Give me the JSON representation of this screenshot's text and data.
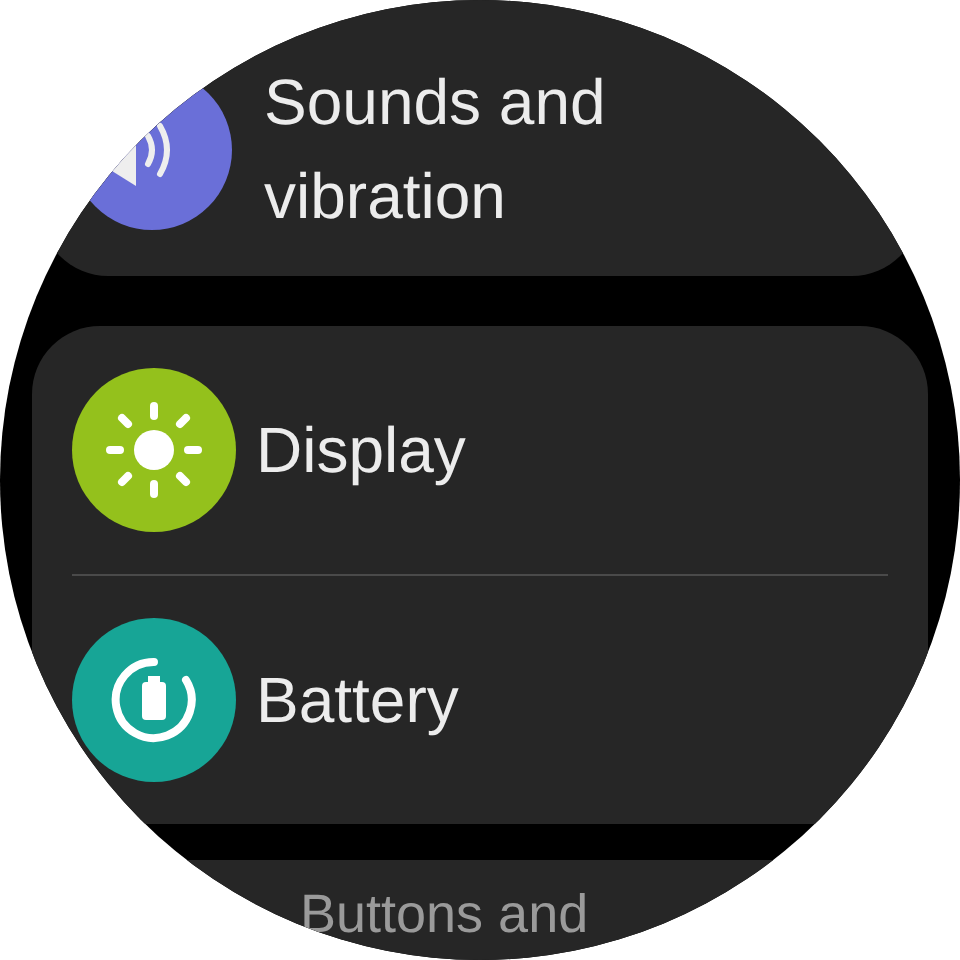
{
  "cards": [
    {
      "items": [
        {
          "label": "Sounds and vibration",
          "kind": "sound",
          "color": "#6a6fd8"
        }
      ]
    },
    {
      "items": [
        {
          "label": "Display",
          "kind": "display",
          "color": "#94c11c"
        },
        {
          "label": "Battery",
          "kind": "battery",
          "color": "#17a596"
        }
      ]
    },
    {
      "items": [
        {
          "label": "Buttons and",
          "kind": "none"
        }
      ]
    }
  ]
}
